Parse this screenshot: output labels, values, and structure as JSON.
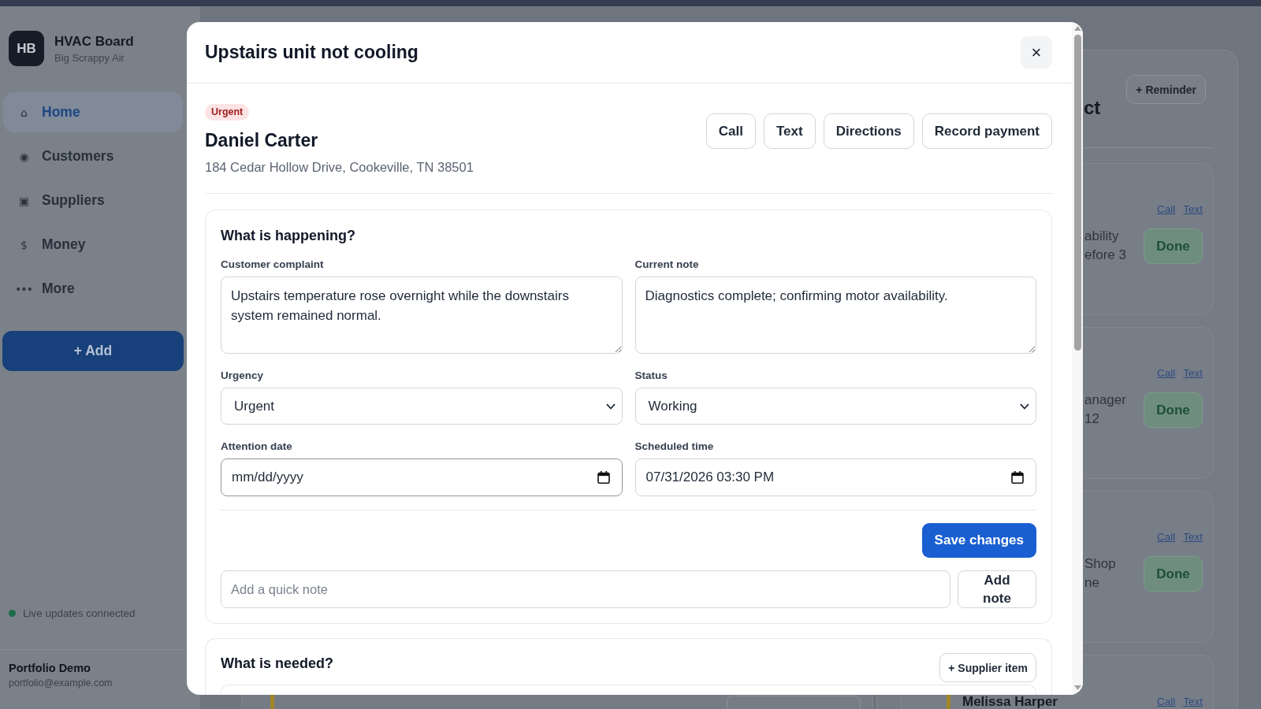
{
  "sidebar": {
    "logo": "HB",
    "app_name": "HVAC Board",
    "company": "Big Scrappy Air",
    "nav": [
      {
        "icon": "⌂",
        "label": "Home",
        "selected": true
      },
      {
        "icon": "◉",
        "label": "Customers",
        "selected": false
      },
      {
        "icon": "▣",
        "label": "Suppliers",
        "selected": false
      },
      {
        "icon": "$",
        "label": "Money",
        "selected": false
      },
      {
        "icon": "•••",
        "label": "More",
        "selected": false
      }
    ],
    "add_button": "+ Add",
    "status": {
      "text": "Live updates connected",
      "connected": true
    },
    "user": {
      "name": "Portfolio Demo",
      "email": "portfolio@example.com"
    }
  },
  "board": {
    "left_card": {
      "color": "#a08726"
    },
    "panel": {
      "heading": "ct",
      "reminder_button": "+ Reminder",
      "cards": [
        {
          "lines": [
            "ability",
            "efore 3"
          ],
          "links": [
            "Call",
            "Text"
          ],
          "done_button": "Done"
        },
        {
          "lines": [
            "anager",
            "12"
          ],
          "links": [
            "Call",
            "Text"
          ],
          "done_button": "Done"
        },
        {
          "lines": [
            "Shop",
            "ne"
          ],
          "links": [
            "Call",
            "Text"
          ],
          "done_button": "Done"
        },
        {
          "name": "Melissa Harper",
          "color": "#a08726",
          "links": [
            "Call",
            "Text"
          ]
        }
      ]
    }
  },
  "modal": {
    "title": "Upstairs unit not cooling",
    "close": "×",
    "badge": "Urgent",
    "customer": "Daniel Carter",
    "address": "184 Cedar Hollow Drive, Cookeville, TN 38501",
    "actions": [
      "Call",
      "Text",
      "Directions",
      "Record payment"
    ],
    "happening": {
      "heading": "What is happening?",
      "fields": [
        {
          "kind": "textarea",
          "label": "Customer complaint",
          "value": "Upstairs temperature rose overnight while the downstairs system remained normal.",
          "focused": false
        },
        {
          "kind": "textarea",
          "label": "Current note",
          "value": "Diagnostics complete; confirming motor availability.",
          "focused": false
        },
        {
          "kind": "select",
          "label": "Urgency",
          "value": "Urgent",
          "focused": false
        },
        {
          "kind": "select",
          "label": "Status",
          "value": "Working",
          "focused": false
        },
        {
          "kind": "date",
          "label": "Attention date",
          "placeholder": "mm/dd/yyyy",
          "focused": true
        },
        {
          "kind": "date",
          "label": "Scheduled time",
          "value": "07/31/2026 03:30 PM",
          "focused": false
        }
      ],
      "save_button": "Save changes",
      "quick_note": {
        "placeholder": "Add a quick note",
        "button": "Add note"
      }
    },
    "needed": {
      "heading": "What is needed?",
      "add_button": "+ Supplier item"
    }
  }
}
